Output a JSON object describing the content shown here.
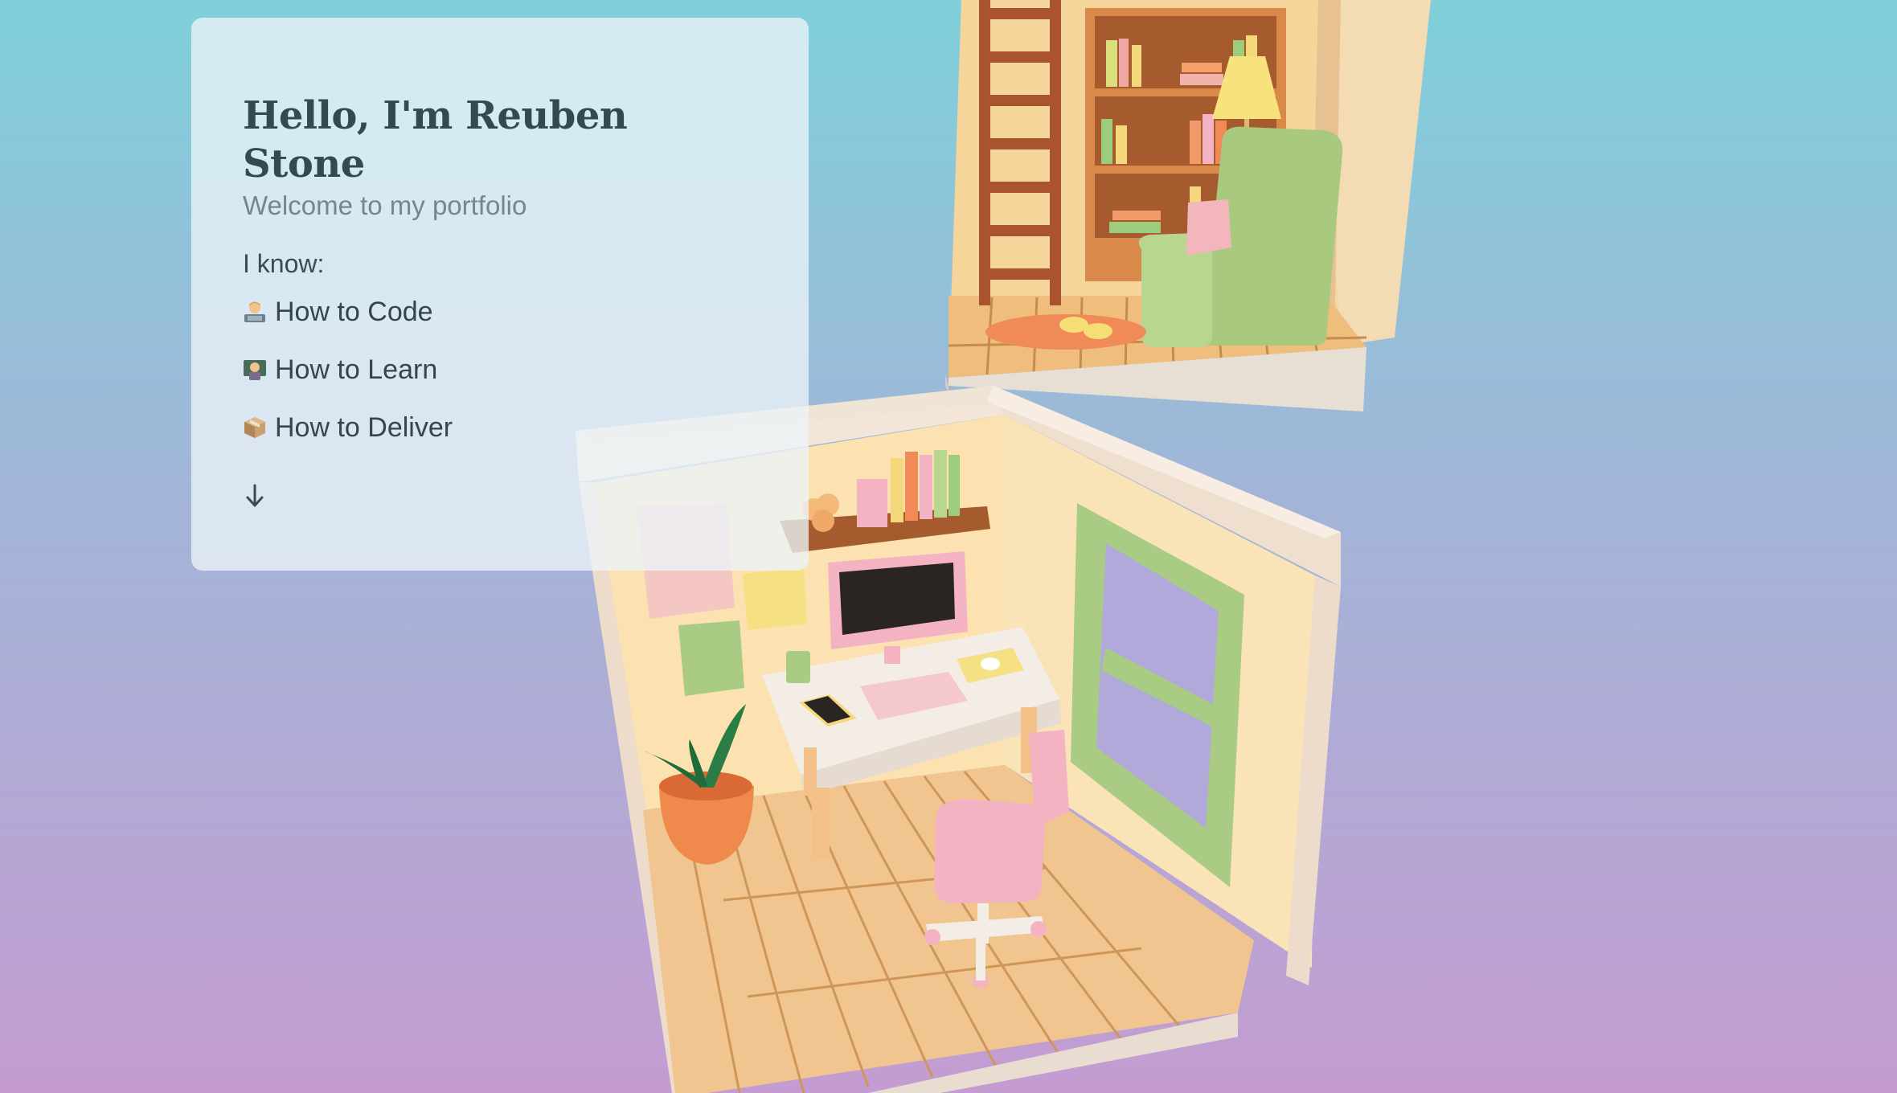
{
  "hero": {
    "title": "Hello, I'm Reuben Stone",
    "subtitle": "Welcome to my portfolio",
    "know_label": "I know:",
    "skills": [
      {
        "icon": "technologist-icon",
        "label": "How to Code"
      },
      {
        "icon": "teacher-icon",
        "label": "How to Learn"
      },
      {
        "icon": "package-icon",
        "label": "How to Deliver"
      }
    ],
    "scroll_icon": "arrow-down-icon"
  },
  "scene": {
    "description_icon": "isometric-room-illustration"
  },
  "colors": {
    "bg_top": "#7fd0db",
    "bg_bottom": "#c49cd2",
    "title": "#344a52",
    "subtitle": "#74868e"
  }
}
